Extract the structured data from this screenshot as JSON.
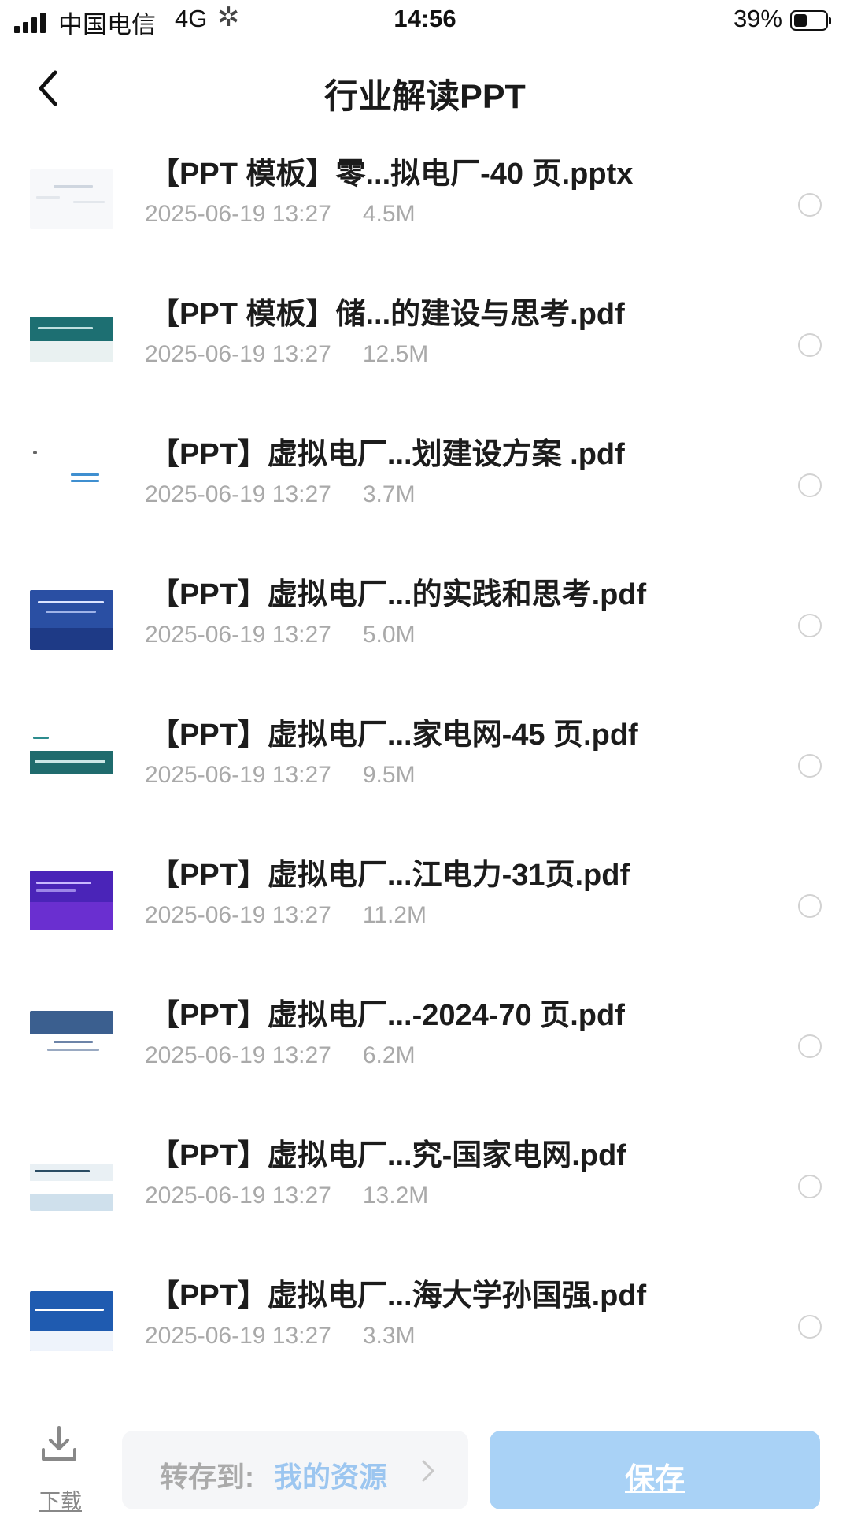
{
  "status_bar": {
    "carrier": "中国电信",
    "network": "4G",
    "time": "14:56",
    "battery": "39%"
  },
  "header": {
    "title": "行业解读PPT"
  },
  "files": [
    {
      "name": "【PPT 模板】零...拟电厂-40 页.pptx",
      "date": "2025-06-19 13:27",
      "size": "4.5M"
    },
    {
      "name": "【PPT 模板】储...的建设与思考.pdf",
      "date": "2025-06-19 13:27",
      "size": "12.5M"
    },
    {
      "name": "【PPT】虚拟电厂...划建设方案 .pdf",
      "date": "2025-06-19 13:27",
      "size": "3.7M"
    },
    {
      "name": "【PPT】虚拟电厂...的实践和思考.pdf",
      "date": "2025-06-19 13:27",
      "size": "5.0M"
    },
    {
      "name": "【PPT】虚拟电厂...家电网-45 页.pdf",
      "date": "2025-06-19 13:27",
      "size": "9.5M"
    },
    {
      "name": "【PPT】虚拟电厂...江电力-31页.pdf",
      "date": "2025-06-19 13:27",
      "size": "11.2M"
    },
    {
      "name": "【PPT】虚拟电厂...-2024-70 页.pdf",
      "date": "2025-06-19 13:27",
      "size": "6.2M"
    },
    {
      "name": "【PPT】虚拟电厂...究-国家电网.pdf",
      "date": "2025-06-19 13:27",
      "size": "13.2M"
    },
    {
      "name": "【PPT】虚拟电厂...海大学孙国强.pdf",
      "date": "2025-06-19 13:27",
      "size": "3.3M"
    }
  ],
  "bottom_bar": {
    "download_label": "下载",
    "save_to_label": "转存到:",
    "save_to_value": "我的资源",
    "save_button": "保存"
  },
  "icons": {
    "back": "chevron-left-icon",
    "download": "download-icon",
    "save_to_arrow": "chevron-right-icon"
  },
  "colors": {
    "accent": "#a9d2f6",
    "link": "#9cc6f0",
    "meta_text": "#a9a9a9"
  }
}
